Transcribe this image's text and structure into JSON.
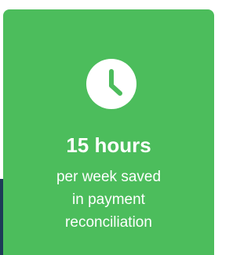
{
  "stat": {
    "icon": "clock-icon",
    "value": "15 hours",
    "description_lines": [
      "per week saved",
      "in payment",
      "reconciliation"
    ]
  },
  "colors": {
    "card_background": "#4cbd5c",
    "icon_background": "#ffffff",
    "text": "#ffffff",
    "edge_accent": "#1d3c57"
  }
}
